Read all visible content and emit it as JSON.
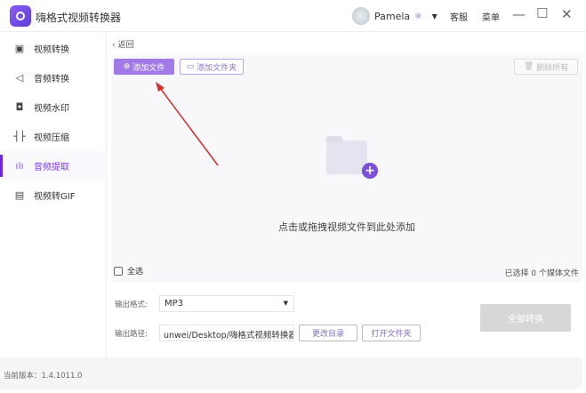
{
  "app": {
    "title": "嗨格式视频转换器",
    "user": "Pamela",
    "support": "客服",
    "menu": "菜单"
  },
  "sidebar": {
    "items": [
      {
        "label": "视频转换",
        "icon": "video-convert-icon"
      },
      {
        "label": "音频转换",
        "icon": "audio-convert-icon"
      },
      {
        "label": "视频水印",
        "icon": "watermark-icon"
      },
      {
        "label": "视频压缩",
        "icon": "compress-icon"
      },
      {
        "label": "音频提取",
        "icon": "audio-extract-icon",
        "active": true
      },
      {
        "label": "视频转GIF",
        "icon": "gif-icon"
      }
    ]
  },
  "main": {
    "back": "返回",
    "add_file": "添加文件",
    "add_folder": "添加文件夹",
    "delete_all": "删除所有",
    "drop_hint": "点击或拖拽视频文件到此处添加",
    "select_all": "全选",
    "selected_count": "已选择 0 个媒体文件",
    "format_label": "输出格式:",
    "format_value": "MP3",
    "path_label": "输出路径:",
    "path_value": "unwei/Desktop/嗨格式视频转换器",
    "change_dir": "更改目录",
    "open_folder": "打开文件夹",
    "convert_all": "全部转换"
  },
  "footer": {
    "version": "当前版本：1.4.1011.0"
  },
  "colors": {
    "accent": "#7c3aed",
    "arrow": "#d32f2f"
  }
}
